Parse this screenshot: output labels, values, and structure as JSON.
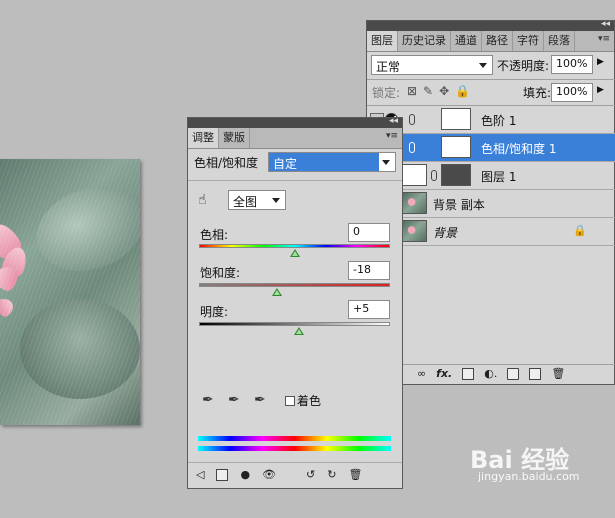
{
  "layers_panel": {
    "tabs": [
      "图层",
      "历史记录",
      "通道",
      "路径",
      "字符",
      "段落"
    ],
    "blend_mode": "正常",
    "opacity_label": "不透明度:",
    "opacity_value": "100%",
    "lock_label": "锁定:",
    "fill_label": "填充:",
    "fill_value": "100%",
    "layers": [
      {
        "name": "色阶 1",
        "type": "adjustment"
      },
      {
        "name": "色相/饱和度 1",
        "type": "adjustment",
        "selected": true
      },
      {
        "name": "图层 1",
        "type": "pixel"
      },
      {
        "name": "背景 副本",
        "type": "image"
      },
      {
        "name": "背景",
        "type": "background",
        "locked": true
      }
    ],
    "bottom_icons": [
      "link-icon",
      "fx-icon",
      "mask-icon",
      "adjustment-icon",
      "folder-icon",
      "new-layer-icon",
      "trash-icon"
    ],
    "fx_label": "fx."
  },
  "adjust_panel": {
    "tabs": [
      "调整",
      "蒙版"
    ],
    "title": "色相/饱和度",
    "preset": "自定",
    "channel": "全图",
    "hue_label": "色相:",
    "hue_value": "0",
    "hue_level": 0.5,
    "saturation_label": "饱和度:",
    "saturation_value": "-18",
    "saturation_level": 0.41,
    "lightness_label": "明度:",
    "lightness_value": "+5",
    "lightness_level": 0.525,
    "colorize_label": "着色",
    "colorize_checked": false
  },
  "colors": {
    "selected_row": "#3a7fd8",
    "panel_bg": "#d6d6d6"
  },
  "watermark": {
    "brand": "Bai 经验",
    "url": "jingyan.baidu.com"
  }
}
